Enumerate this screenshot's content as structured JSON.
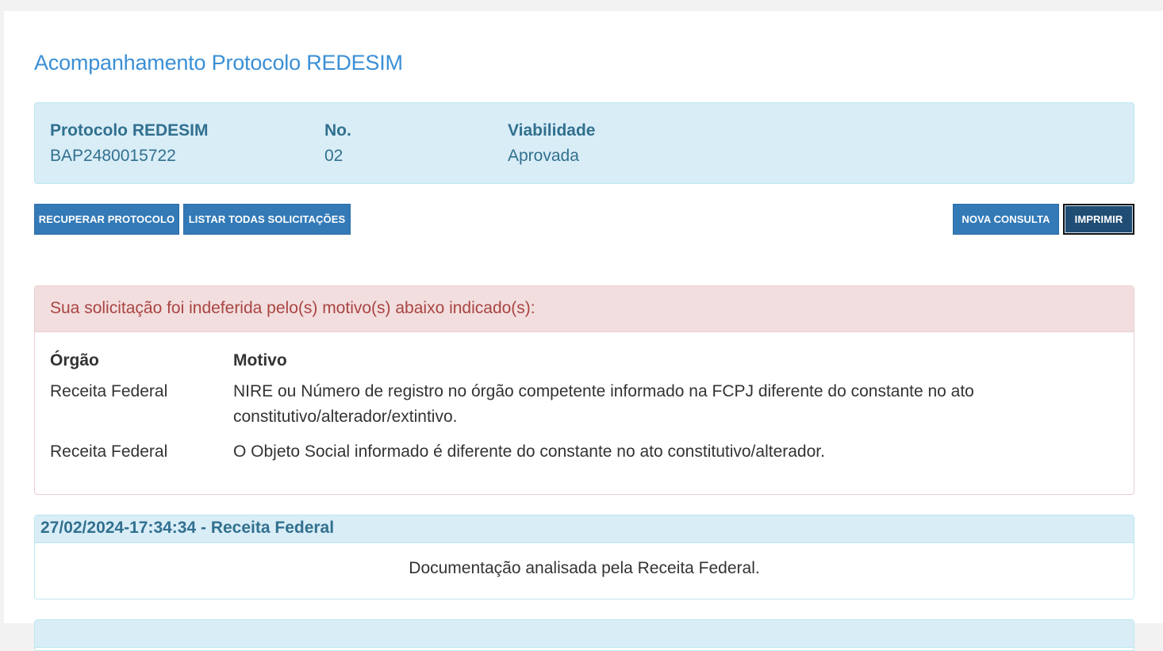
{
  "page": {
    "title": "Acompanhamento Protocolo REDESIM"
  },
  "info": {
    "protocolo_label": "Protocolo REDESIM",
    "protocolo_value": "BAP2480015722",
    "no_label": "No.",
    "no_value": "02",
    "viabilidade_label": "Viabilidade",
    "viabilidade_value": "Aprovada"
  },
  "buttons": {
    "recuperar": "RECUPERAR PROTOCOLO",
    "listar": "LISTAR TODAS SOLICITAÇÕES",
    "nova_consulta": "NOVA CONSULTA",
    "imprimir": "IMPRIMIR"
  },
  "indeferimento": {
    "heading": "Sua solicitação foi indeferida pelo(s) motivo(s) abaixo indicado(s):",
    "col_orgao": "Órgão",
    "col_motivo": "Motivo",
    "rows": [
      {
        "orgao": "Receita Federal",
        "motivo_line1": "NIRE ou Número de registro no órgão competente informado na FCPJ diferente do constante no ato",
        "motivo_line2": "constitutivo/alterador/extintivo."
      },
      {
        "orgao": "Receita Federal",
        "motivo_line1": "O Objeto Social informado é diferente do constante no ato constitutivo/alterador."
      }
    ]
  },
  "events": [
    {
      "header": "27/02/2024-17:34:34 - Receita Federal",
      "body": "Documentação analisada pela Receita Federal."
    },
    {
      "header": "",
      "body": ""
    }
  ],
  "colors": {
    "title": "#3a8fd6",
    "info_bg": "#d9edf7",
    "info_text": "#31708f",
    "button": "#337ab7",
    "button_active": "#204d74",
    "danger_bg": "#f2dede",
    "danger_text": "#a94442"
  }
}
